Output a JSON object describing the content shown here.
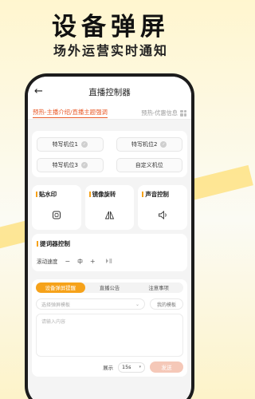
{
  "hero": {
    "title": "设备弹屏",
    "subtitle": "场外运营实时通知"
  },
  "nav": {
    "back_icon": "back-arrow-icon",
    "title": "直播控制器"
  },
  "tabs": {
    "active": "预热-主播介绍/直播主题强调",
    "inactive": "预热-优惠信息"
  },
  "positions": [
    "特写机位1",
    "特写机位2",
    "特写机位3",
    "自定义机位"
  ],
  "features": [
    {
      "label": "贴水印",
      "icon": "watermark-icon"
    },
    {
      "label": "镜像旋转",
      "icon": "mirror-icon"
    },
    {
      "label": "声音控制",
      "icon": "speaker-icon"
    }
  ],
  "prompter": {
    "title": "提词器控制",
    "speed_label": "滚动速度",
    "minus": "−",
    "speed_value": "中",
    "plus": "+"
  },
  "panel": {
    "segments": [
      "设备弹屏提醒",
      "直播公告",
      "注意事项"
    ],
    "active_segment": 0,
    "template_placeholder": "选择弹屏模板",
    "my_template_label": "我的模板",
    "content_placeholder": "请输入内容",
    "display_label": "展示",
    "duration_value": "15s",
    "send_label": "发送"
  },
  "colors": {
    "accent": "#f6a21a",
    "active_tab": "#e95a28"
  }
}
